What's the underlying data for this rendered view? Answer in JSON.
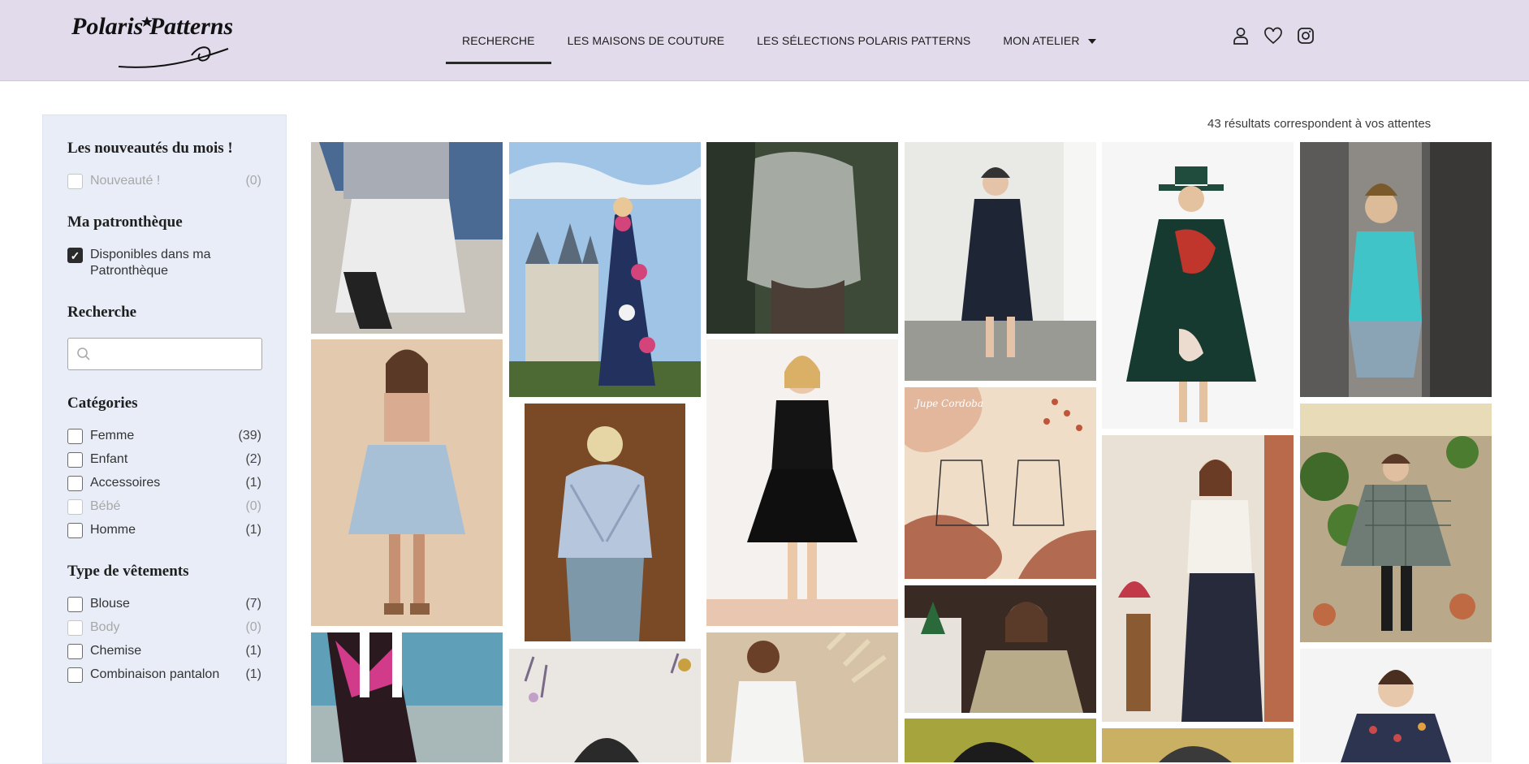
{
  "header": {
    "logo_text": "Polaris Patterns",
    "nav": [
      {
        "label": "RECHERCHE"
      },
      {
        "label": "LES MAISONS DE COUTURE"
      },
      {
        "label": "LES SÉLECTIONS POLARIS PATTERNS"
      },
      {
        "label": "MON ATELIER"
      }
    ],
    "icons": [
      "user-icon",
      "heart-icon",
      "instagram-icon"
    ]
  },
  "sidebar": {
    "nouveautes": {
      "title": "Les nouveautés du mois !",
      "options": [
        {
          "label": "Nouveauté !",
          "count": "(0)",
          "checked": false,
          "disabled": true
        }
      ]
    },
    "patrontheque": {
      "title": "Ma patronthèque",
      "options": [
        {
          "label": "Disponibles dans ma Patronthèque",
          "checked": true
        }
      ]
    },
    "recherche": {
      "title": "Recherche",
      "placeholder": ""
    },
    "categories": {
      "title": "Catégories",
      "options": [
        {
          "label": "Femme",
          "count": "(39)",
          "disabled": false
        },
        {
          "label": "Enfant",
          "count": "(2)",
          "disabled": false
        },
        {
          "label": "Accessoires",
          "count": "(1)",
          "disabled": false
        },
        {
          "label": "Bébé",
          "count": "(0)",
          "disabled": true
        },
        {
          "label": "Homme",
          "count": "(1)",
          "disabled": false
        }
      ]
    },
    "types": {
      "title": "Type de vêtements",
      "options": [
        {
          "label": "Blouse",
          "count": "(7)",
          "disabled": false
        },
        {
          "label": "Body",
          "count": "(0)",
          "disabled": true
        },
        {
          "label": "Chemise",
          "count": "(1)",
          "disabled": false
        },
        {
          "label": "Combinaison pantalon",
          "count": "(1)",
          "disabled": false
        }
      ]
    }
  },
  "results": {
    "count_text": "43 résultats correspondent à vos attentes",
    "cards": [
      {
        "name": "white-skirt-denim-jacket",
        "theme": "denim"
      },
      {
        "name": "floral-maxi-dress-castle",
        "theme": "floral"
      },
      {
        "name": "grey-jacket-back",
        "theme": "forest"
      },
      {
        "name": "navy-long-coat-street",
        "theme": "street"
      },
      {
        "name": "green-red-dress-hat",
        "theme": "greendress"
      },
      {
        "name": "turquoise-tank-top",
        "theme": "turquoise"
      },
      {
        "name": "light-blue-skirt",
        "theme": "blueskirt"
      },
      {
        "name": "striped-blouse-back",
        "theme": "brown"
      },
      {
        "name": "black-velvet-dress",
        "theme": "blackdress"
      },
      {
        "name": "jupe-cordoba-sketch",
        "theme": "sketch",
        "caption": "Jupe Cordoba"
      },
      {
        "name": "striped-wide-pants",
        "theme": "pants"
      },
      {
        "name": "plaid-cape",
        "theme": "cape"
      },
      {
        "name": "swimsuit-back",
        "theme": "swim"
      },
      {
        "name": "metallic-blouse",
        "theme": "metallic"
      },
      {
        "name": "dried-flowers",
        "theme": "flowers"
      },
      {
        "name": "white-top-back",
        "theme": "whitetop"
      },
      {
        "name": "green-partial",
        "theme": "olive"
      },
      {
        "name": "mustard-partial",
        "theme": "mustard"
      },
      {
        "name": "floral-blouse",
        "theme": "floralblouse"
      }
    ]
  }
}
